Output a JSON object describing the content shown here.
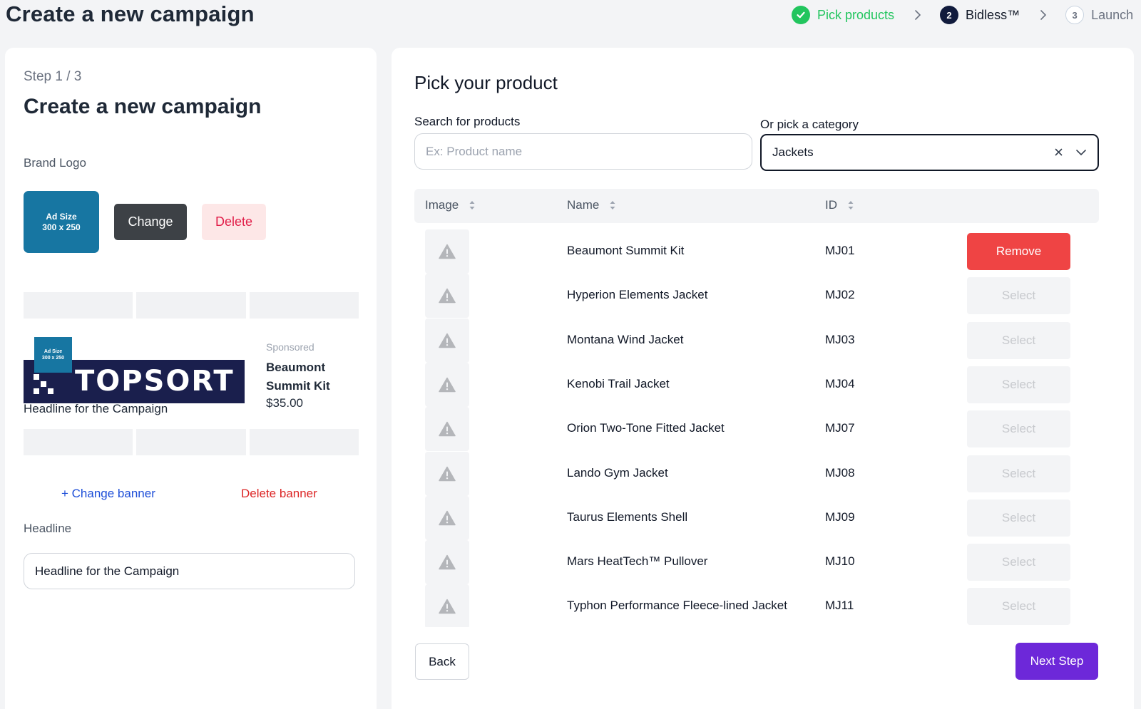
{
  "header": {
    "title": "Create a new campaign",
    "steps": [
      {
        "number": "",
        "label": "Pick products",
        "state": "done",
        "icon": "check-icon"
      },
      {
        "number": "2",
        "label": "Bidless™",
        "state": "active"
      },
      {
        "number": "3",
        "label": "Launch",
        "state": "pending"
      }
    ]
  },
  "left": {
    "step_count": "Step 1 / 3",
    "title": "Create a new campaign",
    "brand_logo_label": "Brand Logo",
    "logo": {
      "line1": "Ad Size",
      "line2": "300 x 250"
    },
    "change_label": "Change",
    "delete_label": "Delete",
    "preview": {
      "banner_text": "TOPSORT",
      "mini_logo_line1": "Ad Size",
      "mini_logo_line2": "300 x 250",
      "headline": "Headline for the Campaign",
      "sponsored": "Sponsored",
      "product_name": "Beaumont Summit Kit",
      "price": "$35.00"
    },
    "change_banner_label": "+ Change banner",
    "delete_banner_label": "Delete banner",
    "headline_label": "Headline",
    "headline_value": "Headline for the Campaign"
  },
  "right": {
    "title": "Pick your product",
    "search_label": "Search for products",
    "search_placeholder": "Ex: Product name",
    "category_label": "Or pick a category",
    "category_value": "Jackets",
    "columns": [
      "Image",
      "Name",
      "ID"
    ],
    "rows": [
      {
        "name": "Beaumont Summit Kit",
        "id": "MJ01",
        "action": "Remove",
        "selected": true
      },
      {
        "name": "Hyperion Elements Jacket",
        "id": "MJ02",
        "action": "Select",
        "selected": false
      },
      {
        "name": "Montana Wind Jacket",
        "id": "MJ03",
        "action": "Select",
        "selected": false
      },
      {
        "name": "Kenobi Trail Jacket",
        "id": "MJ04",
        "action": "Select",
        "selected": false
      },
      {
        "name": "Orion Two-Tone Fitted Jacket",
        "id": "MJ07",
        "action": "Select",
        "selected": false
      },
      {
        "name": "Lando Gym Jacket",
        "id": "MJ08",
        "action": "Select",
        "selected": false
      },
      {
        "name": "Taurus Elements Shell",
        "id": "MJ09",
        "action": "Select",
        "selected": false
      },
      {
        "name": "Mars HeatTech™ Pullover",
        "id": "MJ10",
        "action": "Select",
        "selected": false
      },
      {
        "name": "Typhon Performance Fleece-lined Jacket",
        "id": "MJ11",
        "action": "Select",
        "selected": false
      }
    ],
    "back_label": "Back",
    "next_label": "Next Step"
  },
  "colors": {
    "done": "#22c55e",
    "active_step": "#111b3d",
    "remove": "#ef4444",
    "primary": "#6d28d9",
    "logo_blue": "#1776a2",
    "banner_navy": "#1a1f4d"
  }
}
